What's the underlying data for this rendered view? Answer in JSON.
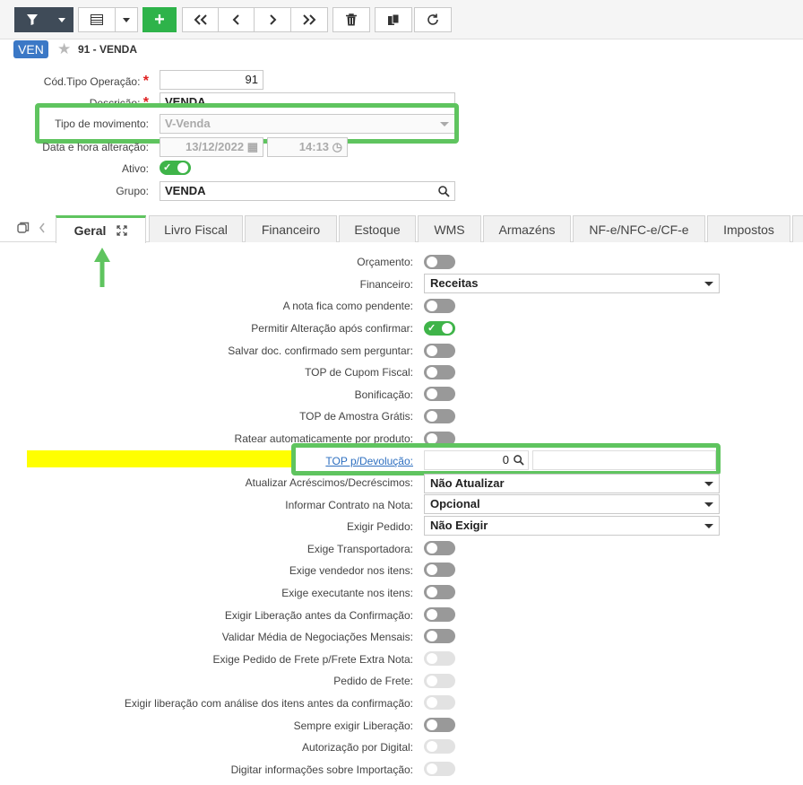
{
  "toolbar": {
    "buttons": [
      {
        "name": "filter-button",
        "icon": "filter-icon"
      },
      {
        "name": "filter-dropdown",
        "icon": "caret-down-icon"
      },
      {
        "name": "grid-view-button",
        "icon": "grid-icon"
      },
      {
        "name": "view-dropdown",
        "icon": "caret-down-icon"
      },
      {
        "name": "add-button",
        "icon": "plus-icon",
        "label": "+"
      },
      {
        "name": "first-record-button",
        "icon": "double-chevron-left-icon"
      },
      {
        "name": "previous-record-button",
        "icon": "chevron-left-icon"
      },
      {
        "name": "next-record-button",
        "icon": "chevron-right-icon"
      },
      {
        "name": "last-record-button",
        "icon": "double-chevron-right-icon"
      },
      {
        "name": "delete-button",
        "icon": "trash-icon"
      },
      {
        "name": "copy-button",
        "icon": "copy-icon"
      },
      {
        "name": "refresh-button",
        "icon": "refresh-icon"
      }
    ]
  },
  "header": {
    "badge": "VEN",
    "title": "91 - VENDA"
  },
  "form": {
    "cod_tipo_label": "Cód.Tipo Operação:",
    "cod_tipo_value": "91",
    "descricao_label": "Descrição:",
    "descricao_value": "VENDA",
    "tipo_mov_label": "Tipo de movimento:",
    "tipo_mov_value": "V-Venda",
    "data_hora_label": "Data e hora alteração:",
    "data_value": "13/12/2022",
    "hora_value": "14:13",
    "ativo_label": "Ativo:",
    "grupo_label": "Grupo:",
    "grupo_value": "VENDA",
    "required_mark": "*"
  },
  "tabs": [
    {
      "label": "Geral",
      "active": true
    },
    {
      "label": "Livro Fiscal"
    },
    {
      "label": "Financeiro"
    },
    {
      "label": "Estoque"
    },
    {
      "label": "WMS"
    },
    {
      "label": "Armazéns"
    },
    {
      "label": "NF-e/NFC-e/CF-e"
    },
    {
      "label": "Impostos"
    }
  ],
  "geral": {
    "orcamento": "Orçamento:",
    "financeiro": "Financeiro:",
    "financeiro_value": "Receitas",
    "nota_pendente": "A nota fica como pendente:",
    "permitir_alteracao": "Permitir Alteração após confirmar:",
    "salvar_doc": "Salvar doc. confirmado sem perguntar:",
    "top_cupom": "TOP de Cupom Fiscal:",
    "bonificacao": "Bonificação:",
    "top_amostra": "TOP de Amostra Grátis:",
    "ratear": "Ratear automaticamente por produto:",
    "top_devolucao": "TOP p/Devolução:",
    "top_devolucao_value": "0",
    "atualizar_acrescimos": "Atualizar Acréscimos/Decréscimos:",
    "atualizar_value": "Não Atualizar",
    "informar_contrato": "Informar Contrato na Nota:",
    "informar_value": "Opcional",
    "exigir_pedido": "Exigir Pedido:",
    "exigir_pedido_value": "Não Exigir",
    "exige_transportadora": "Exige Transportadora:",
    "exige_vendedor": "Exige vendedor nos itens:",
    "exige_executante": "Exige executante nos itens:",
    "exigir_liberacao": "Exigir Liberação antes da Confirmação:",
    "validar_media": "Validar Média de Negociações Mensais:",
    "exige_pedido_frete": "Exige Pedido de Frete p/Frete Extra Nota:",
    "pedido_frete": "Pedido de Frete:",
    "exigir_liberacao_analise": "Exigir liberação com análise dos itens antes da confirmação:",
    "sempre_exigir": "Sempre exigir Liberação:",
    "autorizacao_digital": "Autorização por Digital:",
    "digitar_importacao": "Digitar informações sobre Importação:"
  },
  "colors": {
    "accent_green": "#5fc45f",
    "highlight_yellow": "#ffff00",
    "badge_blue": "#3b78c6",
    "toolbar_dark": "#3f4b58"
  }
}
